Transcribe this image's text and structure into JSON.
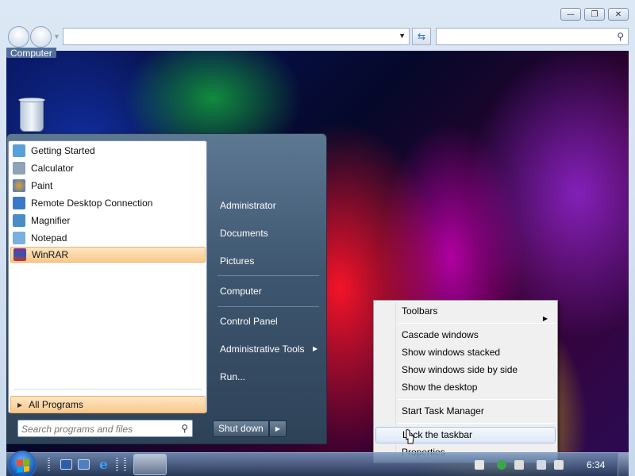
{
  "window": {
    "desktop_label": "Computer",
    "caption_icons": [
      "minimize-icon",
      "restore-icon",
      "close-icon"
    ],
    "address_value": "",
    "search_value": ""
  },
  "start_menu": {
    "programs": [
      {
        "label": "Getting Started",
        "icon": "getting-started-icon",
        "color": "#5aa0d8"
      },
      {
        "label": "Calculator",
        "icon": "calculator-icon",
        "color": "#8fa3b8"
      },
      {
        "label": "Paint",
        "icon": "paint-icon",
        "color": "#e0a030"
      },
      {
        "label": "Remote Desktop Connection",
        "icon": "remote-desktop-icon",
        "color": "#3c78c8"
      },
      {
        "label": "Magnifier",
        "icon": "magnifier-icon",
        "color": "#4a8cc8"
      },
      {
        "label": "Notepad",
        "icon": "notepad-icon",
        "color": "#7ab0e0"
      },
      {
        "label": "WinRAR",
        "icon": "winrar-icon",
        "color": "#8e2a8e",
        "highlighted": true
      }
    ],
    "all_programs_label": "All Programs",
    "search_placeholder": "Search programs and files",
    "right_items": [
      {
        "label": "Administrator"
      },
      {
        "label": "Documents"
      },
      {
        "label": "Pictures"
      },
      {
        "label": "Computer"
      },
      {
        "label": "Control Panel"
      },
      {
        "label": "Administrative Tools"
      },
      {
        "label": "Run..."
      }
    ],
    "shutdown_label": "Shut down"
  },
  "context_menu": {
    "items": [
      {
        "label": "Toolbars",
        "submenu": true
      },
      {
        "label": "Cascade windows"
      },
      {
        "label": "Show windows stacked"
      },
      {
        "label": "Show windows side by side"
      },
      {
        "label": "Show the desktop"
      },
      {
        "label": "Start Task Manager"
      },
      {
        "label": "Lock the taskbar",
        "hover": true
      },
      {
        "label": "Properties"
      }
    ]
  },
  "taskbar": {
    "clock": "6:34"
  },
  "colors": {
    "start_menu_bg": "#3e5670",
    "highlight": "#f9c98b",
    "context_hover_border": "#a8c2e2"
  }
}
